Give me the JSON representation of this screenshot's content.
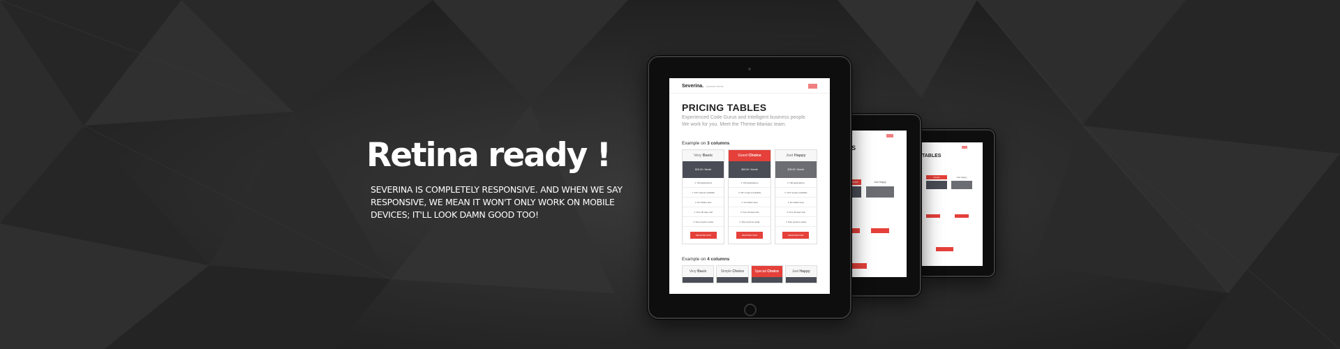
{
  "hero": {
    "title": "Retina ready !",
    "description": "SEVERINA IS COMPLETELY RESPONSIVE. AND WHEN WE SAY RESPONSIVE, WE MEAN IT WON'T ONLY WORK ON MOBILE DEVICES; IT'LL LOOK DAMN GOOD TOO!"
  },
  "colors": {
    "background": "#2a2a2a",
    "accent": "#e5403a",
    "price_dark": "#4a4d55"
  },
  "tablet_screen": {
    "logo": "Severina.",
    "tagline": "business theme",
    "page_title": "PRICING TABLES",
    "subtitle": "Experienced Code Gurus and Intelligent business people. We work for you. Meet the Theme-Maniac team.",
    "example3_prefix": "Example on ",
    "example3_bold": "3 columns",
    "example4_prefix": "Example on ",
    "example4_bold": "4 columns",
    "plans3": [
      {
        "light": "Very ",
        "bold": "Basic",
        "price": "$25.00 / Month",
        "highlight": false
      },
      {
        "light": "Good ",
        "bold": "Choice",
        "price": "$25.00 / Month",
        "highlight": true
      },
      {
        "light": "Just ",
        "bold": "Happy",
        "price": "$25.00 / Month",
        "highlight": false
      }
    ],
    "features": [
      "100 applications",
      "24/7 support available",
      "No hidden fees",
      "Free 30 days trial",
      "Stop anytime easily"
    ],
    "button": "REGISTER NOW",
    "plans4": [
      {
        "light": "Very ",
        "bold": "Basic"
      },
      {
        "light": "Simple ",
        "bold": "Choice"
      },
      {
        "light": "Special ",
        "bold": "Choice"
      },
      {
        "light": "Just ",
        "bold": "Happy"
      }
    ]
  },
  "tablet_mid": {
    "title_fragment": "ES",
    "plan_a": "Choice",
    "plan_b": "Just Happy"
  },
  "tablet_small": {
    "title_fragment": "TABLES",
    "plan_a": "Choice",
    "plan_b": "Just Happy"
  }
}
